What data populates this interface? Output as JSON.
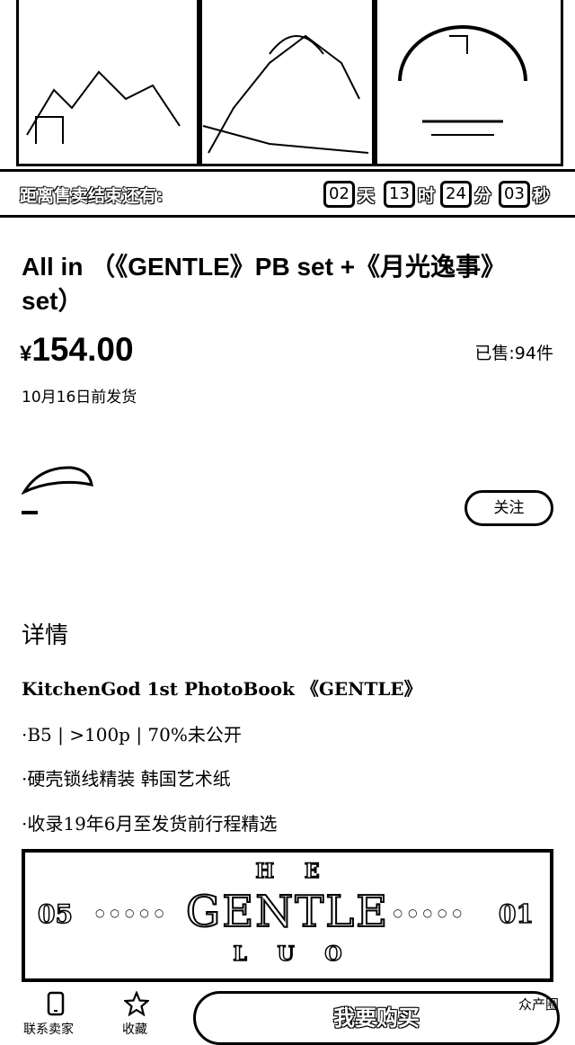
{
  "banner": {
    "countdown_label": "距离售卖结束还有:",
    "days": "02",
    "days_unit": "天",
    "hours": "13",
    "hours_unit": "时",
    "minutes": "24",
    "minutes_unit": "分",
    "seconds": "03",
    "seconds_unit": "秒"
  },
  "product": {
    "title": "All in （《GENTLE》PB set +《月光逸事》set）",
    "currency": "¥",
    "price": "154.00",
    "sold": "已售:94件",
    "shipping": "10月16日前发货"
  },
  "shop": {
    "follow_label": "关注"
  },
  "details": {
    "heading": "详情",
    "lines": [
      "KitchenGod 1st PhotoBook 《GENTLE》",
      "·B5 | >100p | 70%未公开",
      "·硬壳锁线精装 韩国艺术纸",
      "·收录19年6月至发货前行程精选"
    ]
  },
  "promo": {
    "top_text": "H E",
    "main_text": "GENTLE",
    "bottom_text": "L U O",
    "left_number": "05",
    "right_number": "01"
  },
  "bottom_bar": {
    "contact_label": "联系卖家",
    "favorite_label": "收藏",
    "buy_label": "我要购买",
    "watermark": "众产圈"
  }
}
